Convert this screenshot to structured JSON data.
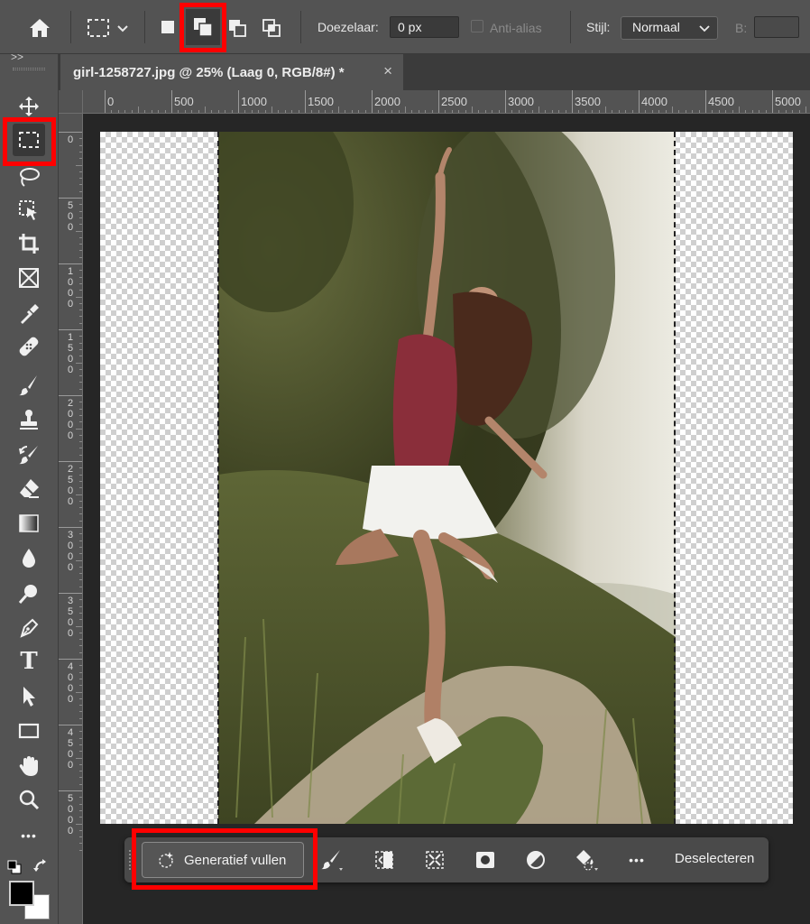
{
  "options_bar": {
    "feather_label": "Doezelaar:",
    "feather_value": "0 px",
    "antialias_label": "Anti-alias",
    "style_label": "Stijl:",
    "style_value": "Normaal",
    "width_label": "B:"
  },
  "toolbar": {
    "collapse_glyph": ">>",
    "tools": [
      "move-icon",
      "rectangular-marquee-icon",
      "lasso-icon",
      "object-selection-icon",
      "crop-icon",
      "frame-icon",
      "eyedropper-icon",
      "spot-healing-icon",
      "brush-icon",
      "clone-stamp-icon",
      "history-brush-icon",
      "eraser-icon",
      "gradient-icon",
      "blur-icon",
      "dodge-icon",
      "pen-icon",
      "type-icon",
      "path-selection-icon",
      "rectangle-icon",
      "hand-icon",
      "zoom-icon",
      "more-tools-icon"
    ],
    "type_glyph": "T",
    "more_glyph": "•••",
    "foreground_color": "#000000",
    "background_color": "#ffffff"
  },
  "document": {
    "tab_title": "girl-1258727.jpg @ 25% (Laag 0, RGB/8#) *",
    "close_glyph": "×"
  },
  "rulers": {
    "horizontal_ticks": [
      "0",
      "500",
      "1000",
      "1500",
      "2000",
      "2500",
      "3000",
      "3500",
      "4000",
      "4500",
      "5000"
    ],
    "vertical_ticks": [
      "0",
      "500",
      "1000",
      "1500",
      "2000",
      "2500",
      "3000",
      "3500",
      "4000",
      "4500",
      "5000"
    ]
  },
  "context_bar": {
    "generative_fill_label": "Generatief vullen",
    "more_glyph": "•••",
    "deselect_label": "Deselecteren"
  },
  "colors": {
    "highlight": "#ff0000",
    "panel": "#535353",
    "canvas_bg": "#262626"
  }
}
